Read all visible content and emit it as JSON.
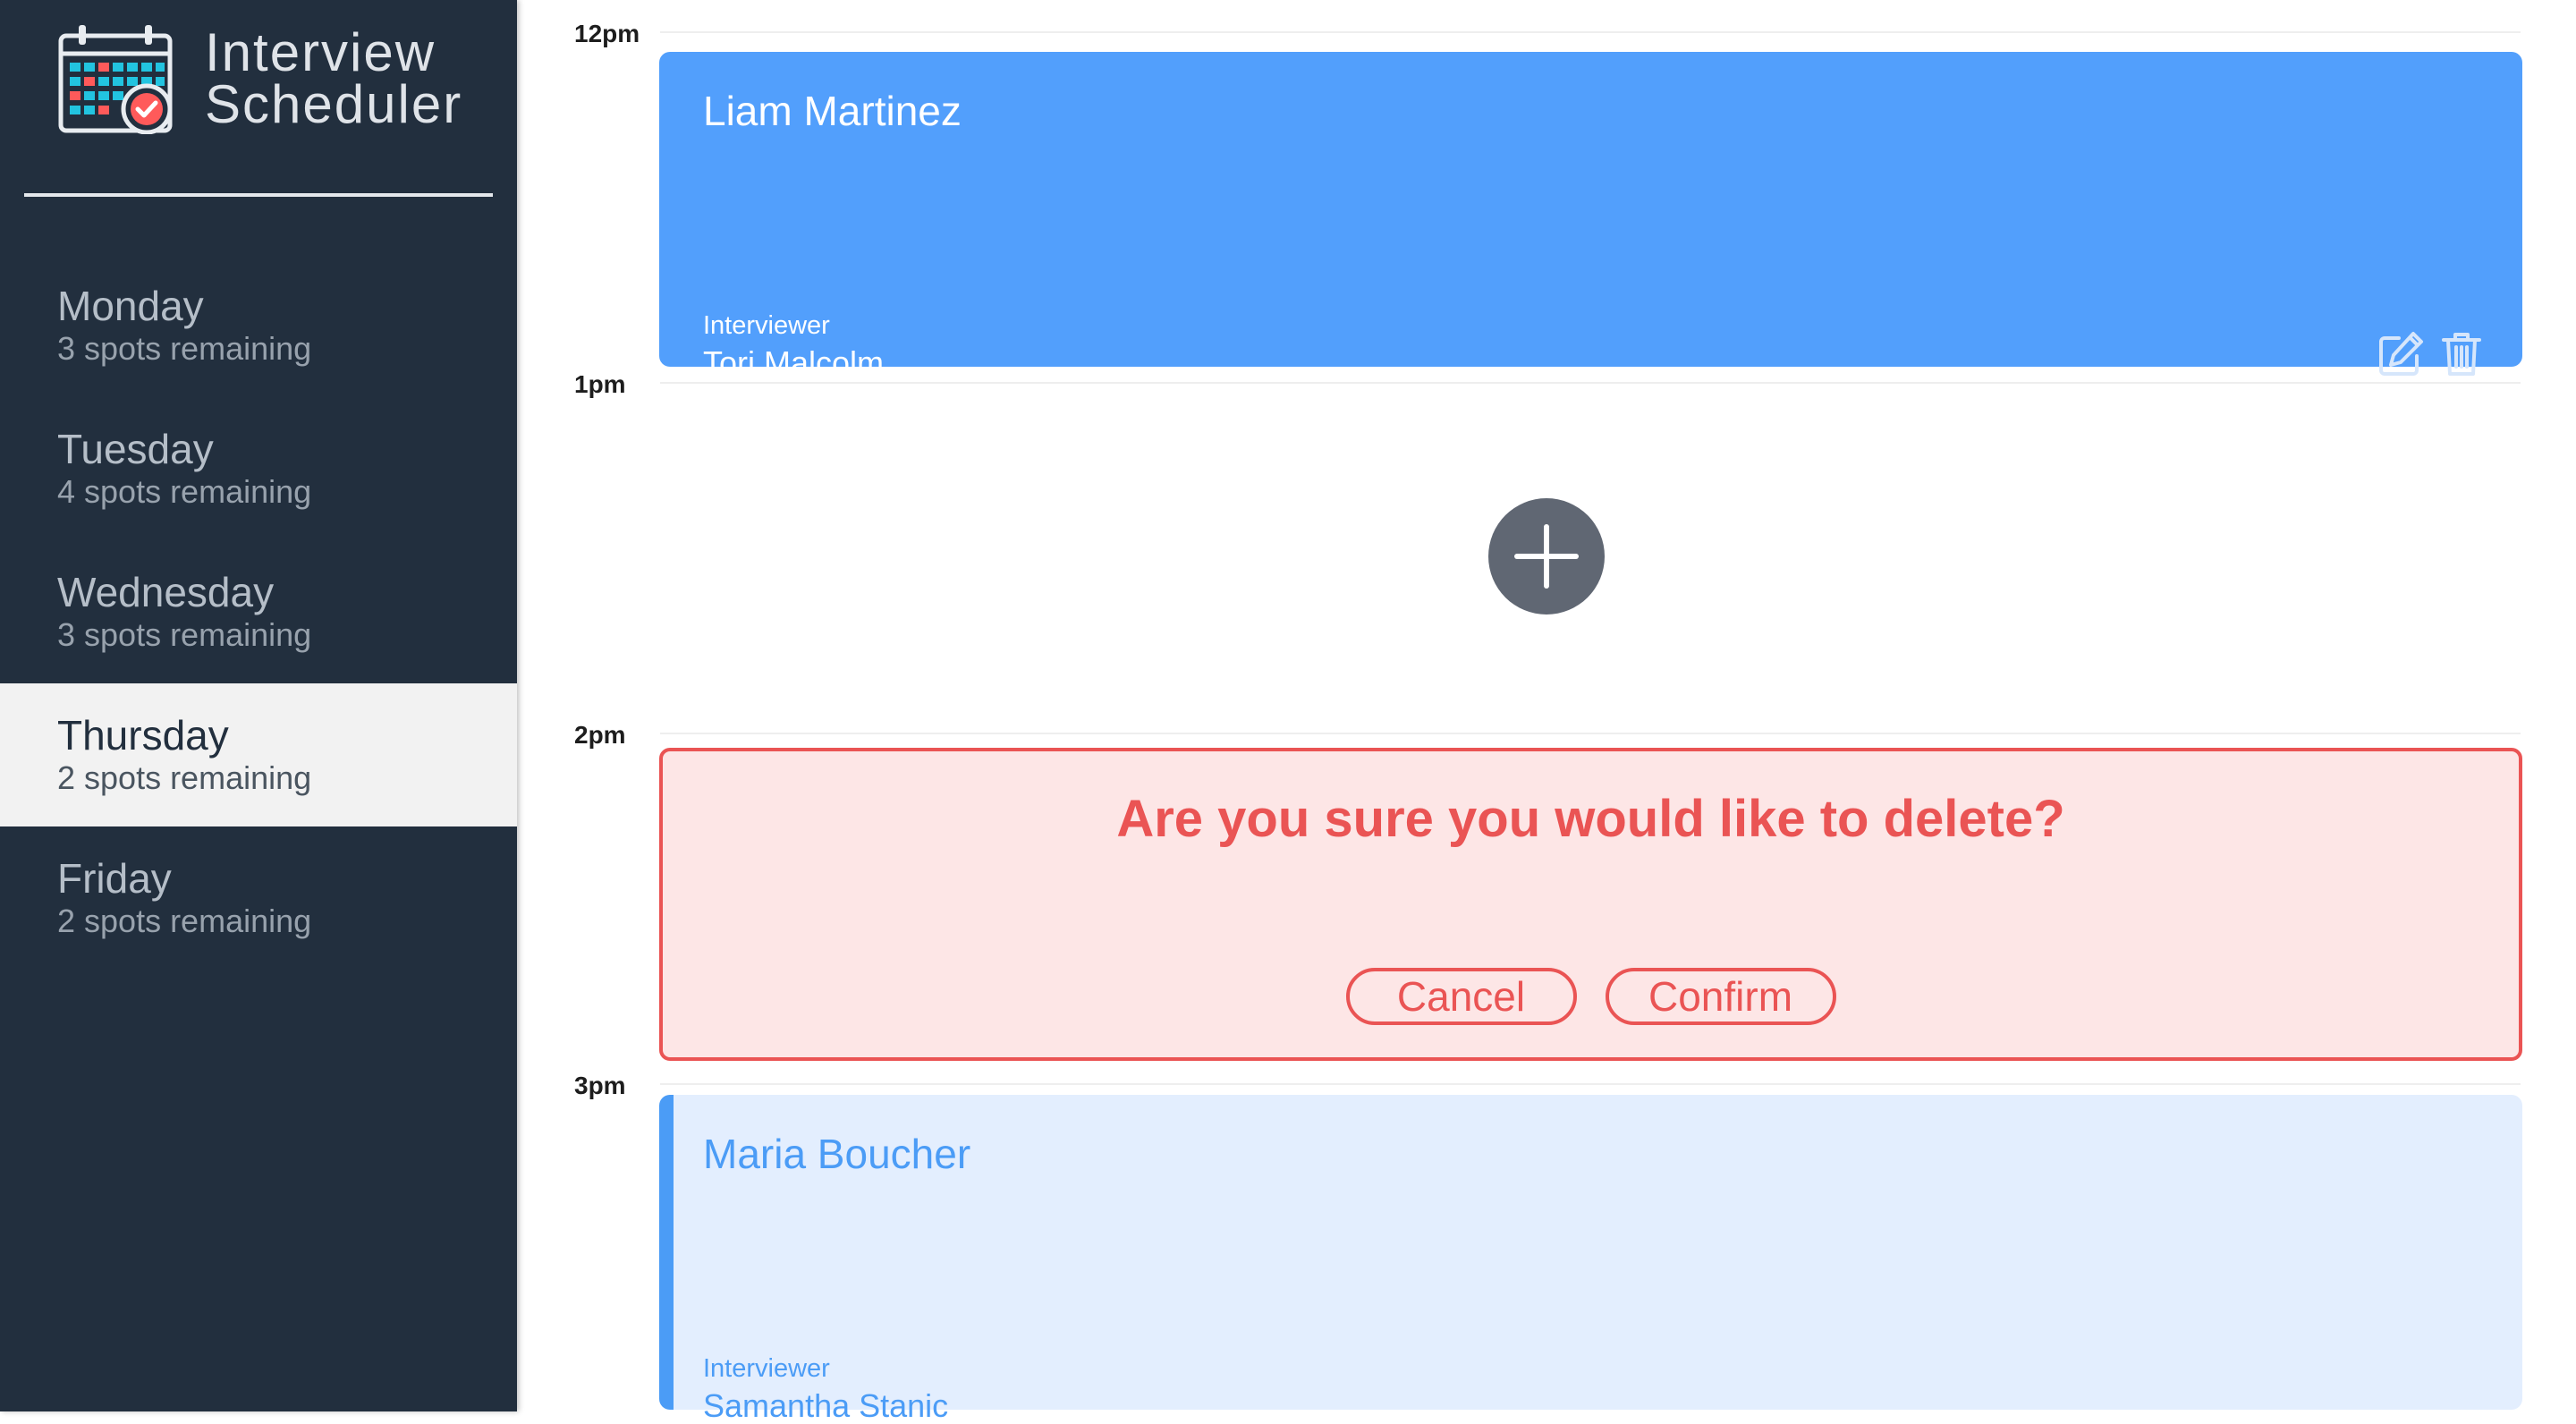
{
  "app": {
    "title_line1": "Interview",
    "title_line2": "Scheduler"
  },
  "sidebar": {
    "days": [
      {
        "name": "Monday",
        "spots": "3 spots remaining",
        "selected": false
      },
      {
        "name": "Tuesday",
        "spots": "4 spots remaining",
        "selected": false
      },
      {
        "name": "Wednesday",
        "spots": "3 spots remaining",
        "selected": false
      },
      {
        "name": "Thursday",
        "spots": "2 spots remaining",
        "selected": true
      },
      {
        "name": "Friday",
        "spots": "2 spots remaining",
        "selected": false
      }
    ]
  },
  "schedule": {
    "times": [
      "12pm",
      "1pm",
      "2pm",
      "3pm"
    ],
    "appointments": {
      "booked": {
        "student": "Liam Martinez",
        "interviewer_label": "Interviewer",
        "interviewer": "Tori Malcolm"
      },
      "confirm": {
        "message": "Are you sure you would like to delete?",
        "cancel_label": "Cancel",
        "confirm_label": "Confirm"
      },
      "upcoming": {
        "student": "Maria Boucher",
        "interviewer_label": "Interviewer",
        "interviewer": "Samantha Stanic"
      }
    }
  },
  "colors": {
    "sidebar_bg": "#222f3e",
    "booked_bg": "#529ffc",
    "danger": "#ea5454",
    "danger_bg": "#fde6e6",
    "light_bg": "#e3eefe",
    "accent": "#4b9cf6",
    "add_button": "#606773"
  },
  "icons": {
    "logo": "calendar-check-icon",
    "edit": "edit-icon",
    "delete": "trash-icon",
    "add": "plus-icon"
  }
}
